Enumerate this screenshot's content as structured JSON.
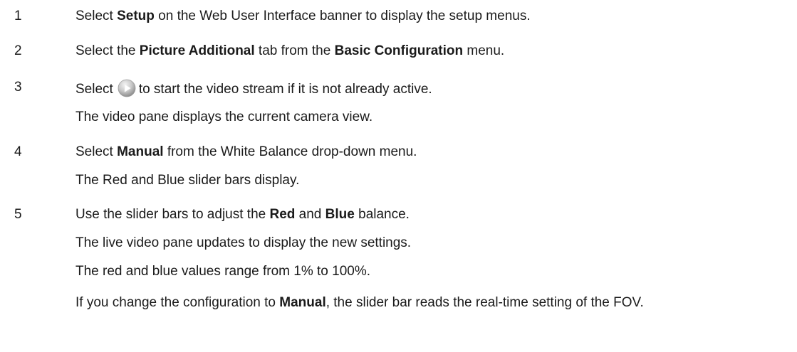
{
  "steps": [
    {
      "number": "1",
      "parts": [
        {
          "t": "Select ",
          "b": false
        },
        {
          "t": "Setup",
          "b": true
        },
        {
          "t": " on the Web User Interface banner to display the setup menus.",
          "b": false
        }
      ]
    },
    {
      "number": "2",
      "parts": [
        {
          "t": "Select the ",
          "b": false
        },
        {
          "t": "Picture Additional",
          "b": true
        },
        {
          "t": " tab from the ",
          "b": false
        },
        {
          "t": "Basic Configuration",
          "b": true
        },
        {
          "t": " menu.",
          "b": false
        }
      ]
    },
    {
      "number": "3",
      "before_icon": "Select",
      "icon": "play-button-icon",
      "after_icon": "to start the video stream if it is not already active.",
      "result": "The video pane displays the current camera view."
    },
    {
      "number": "4",
      "parts": [
        {
          "t": "Select ",
          "b": false
        },
        {
          "t": "Manual",
          "b": true
        },
        {
          "t": " from the White Balance drop-down menu.",
          "b": false
        }
      ],
      "result": "The Red and Blue slider bars display."
    },
    {
      "number": "5",
      "parts": [
        {
          "t": "Use the slider bars to adjust the ",
          "b": false
        },
        {
          "t": "Red",
          "b": true
        },
        {
          "t": " and ",
          "b": false
        },
        {
          "t": "Blue",
          "b": true
        },
        {
          "t": " balance.",
          "b": false
        }
      ],
      "results": [
        "The live video pane updates to display the new settings.",
        "The red and blue values range from 1% to 100%."
      ],
      "note_parts": [
        {
          "t": "If you change the configuration to ",
          "b": false
        },
        {
          "t": "Manual",
          "b": true
        },
        {
          "t": ", the slider bar reads the real-time setting of the FOV.",
          "b": false
        }
      ]
    }
  ]
}
